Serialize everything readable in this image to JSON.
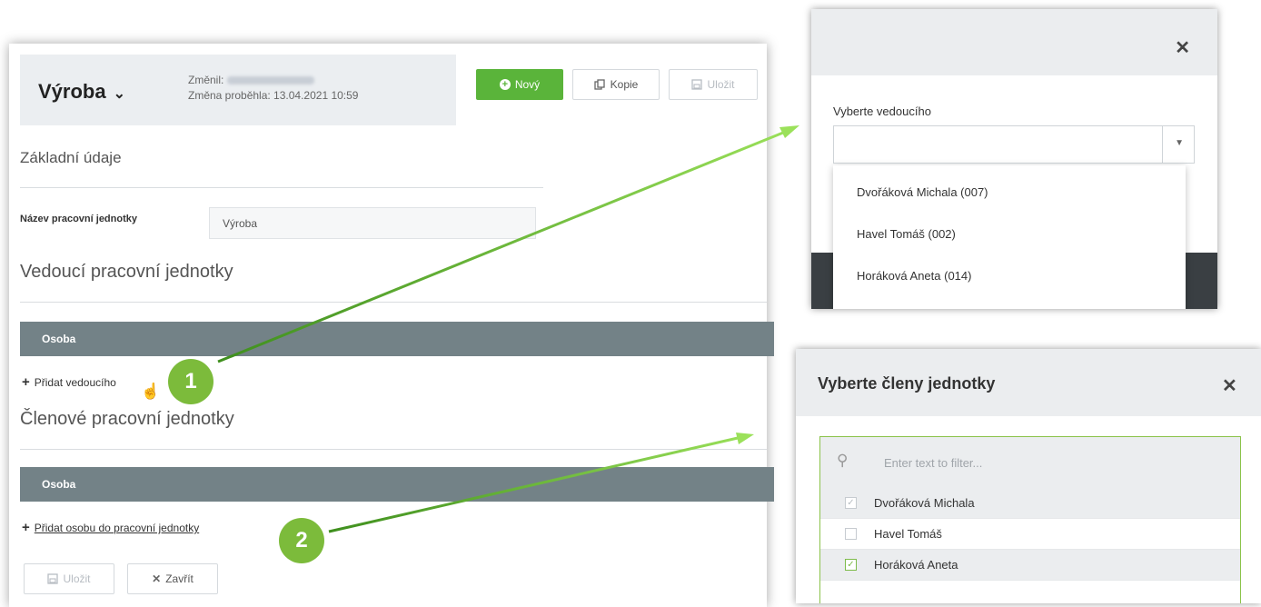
{
  "header": {
    "unit_name": "Výroba",
    "changed_by_label": "Změnil:",
    "change_time": "Změna proběhla: 13.04.2021 10:59"
  },
  "toolbar": {
    "new_label": "Nový",
    "copy_label": "Kopie",
    "save_label": "Uložit"
  },
  "basic": {
    "title": "Základní údaje",
    "field_label": "Název pracovní jednotky",
    "field_value": "Výroba"
  },
  "leaders": {
    "title": "Vedoucí pracovní jednotky",
    "column": "Osoba",
    "add_link": "Přidat vedoucího"
  },
  "members": {
    "title": "Členové pracovní jednotky",
    "column": "Osoba",
    "add_link": "Přidat osobu do pracovní jednotky"
  },
  "footer": {
    "save_label": "Uložit",
    "close_label": "Zavřít"
  },
  "leader_dialog": {
    "label": "Vyberte vedoucího",
    "options": [
      "Dvořáková Michala (007)",
      "Havel Tomáš (002)",
      "Horáková Aneta (014)"
    ]
  },
  "member_dialog": {
    "title": "Vyberte členy jednotky",
    "filter_placeholder": "Enter text to filter...",
    "members": [
      {
        "name": "Dvořáková Michala",
        "checked": true
      },
      {
        "name": "Havel Tomáš",
        "checked": false
      },
      {
        "name": "Horáková Aneta",
        "checked": true
      }
    ]
  },
  "annotations": {
    "step1": "1",
    "step2": "2"
  },
  "colors": {
    "accent_green": "#5ab43a",
    "table_header": "#738287",
    "badge_green": "#7cbb3b"
  }
}
